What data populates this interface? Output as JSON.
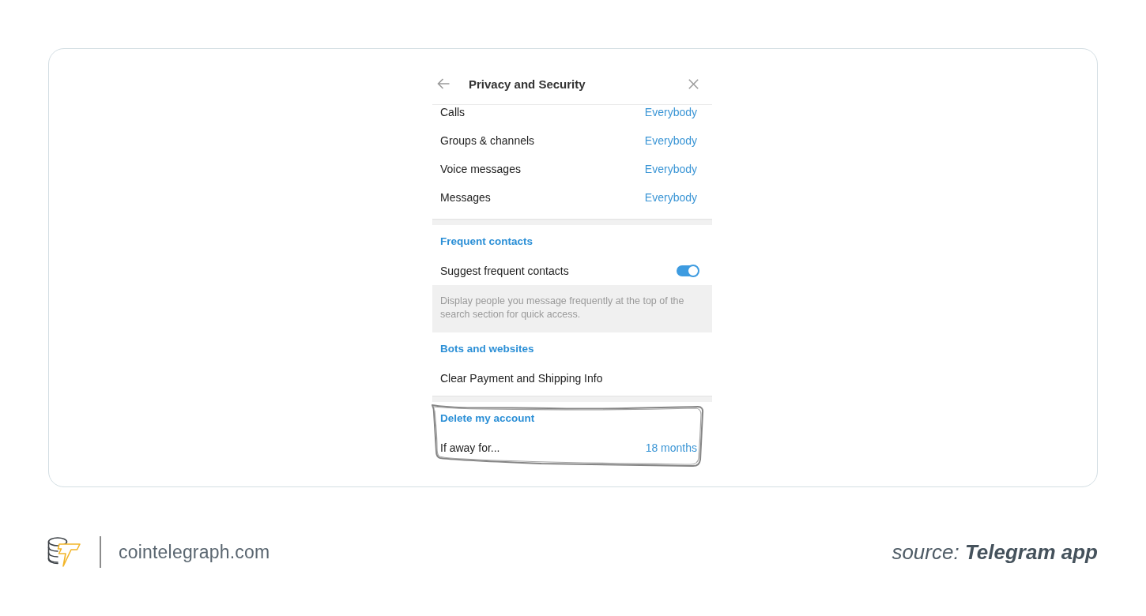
{
  "panel": {
    "title": "Privacy and Security"
  },
  "privacy_rows": [
    {
      "label": "Calls",
      "value": "Everybody"
    },
    {
      "label": "Groups & channels",
      "value": "Everybody"
    },
    {
      "label": "Voice messages",
      "value": "Everybody"
    },
    {
      "label": "Messages",
      "value": "Everybody"
    }
  ],
  "sections": [
    {
      "heading": "Frequent contacts",
      "rows": [
        {
          "kind": "toggle",
          "label": "Suggest frequent contacts",
          "on": true
        }
      ],
      "note": "Display people you message frequently at the top of the search section for quick access.",
      "circled": false
    },
    {
      "heading": "Bots and websites",
      "rows": [
        {
          "kind": "button",
          "label": "Clear Payment and Shipping Info"
        }
      ],
      "circled": false
    },
    {
      "heading": "Delete my account",
      "rows": [
        {
          "kind": "value",
          "label": "If away for...",
          "value": "18 months"
        }
      ],
      "circled": true
    }
  ],
  "footer": {
    "site": "cointelegraph.com",
    "source": "source: **Telegram app**"
  }
}
